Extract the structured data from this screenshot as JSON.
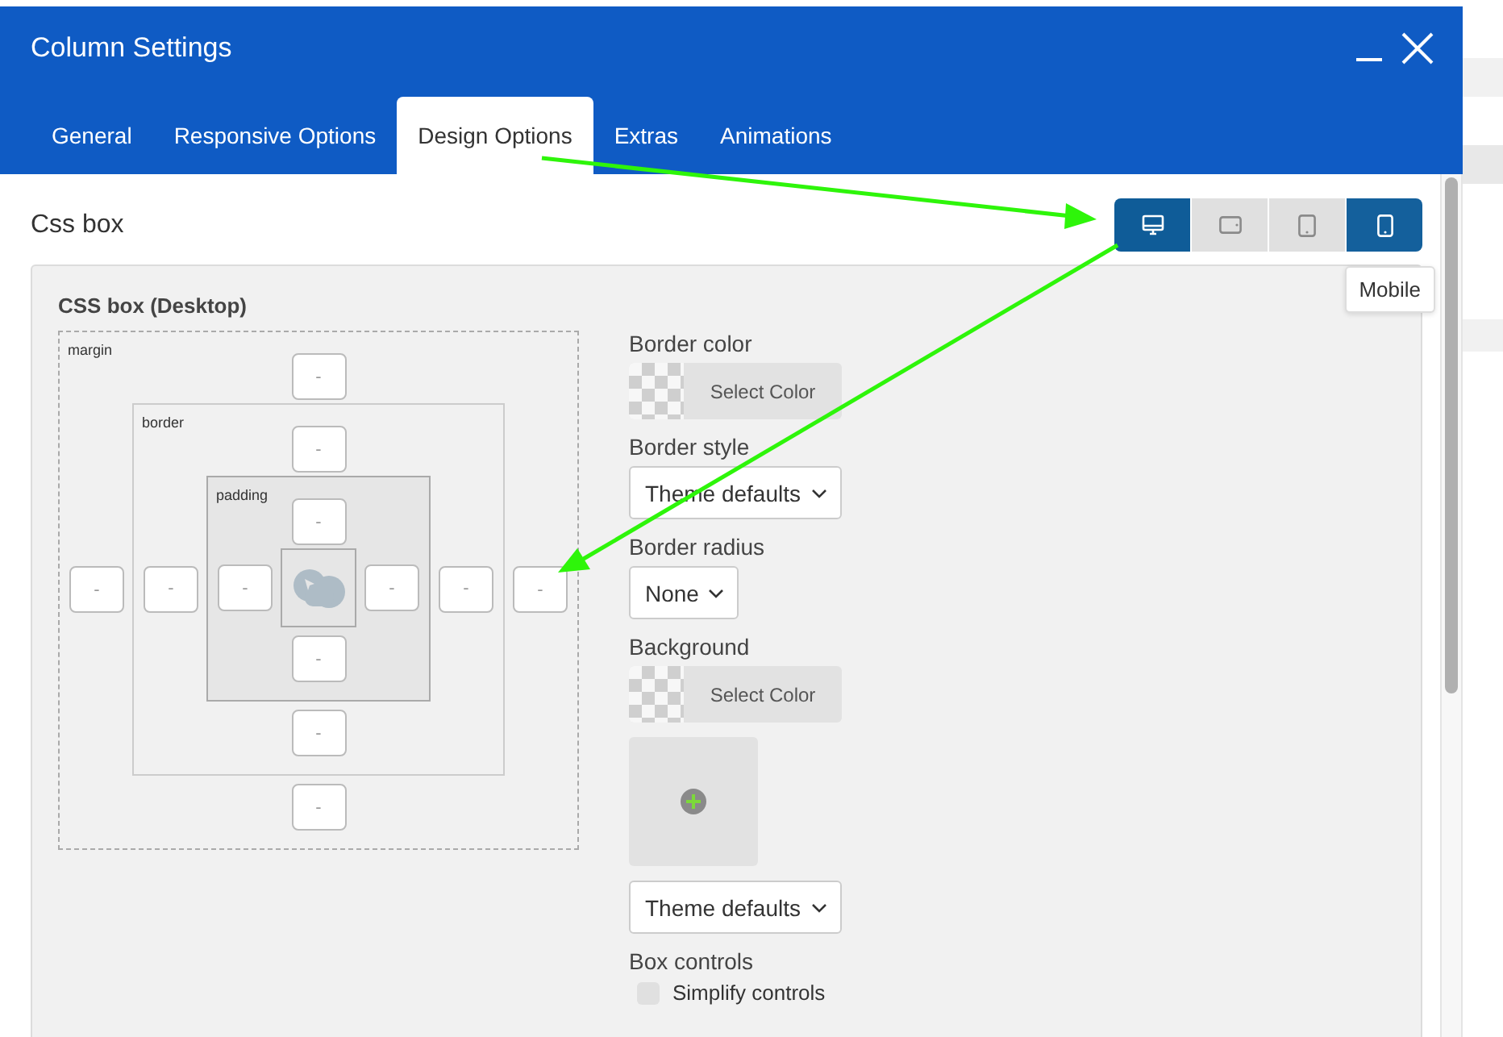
{
  "window": {
    "title": "Column Settings"
  },
  "tabs": [
    {
      "label": "General",
      "selected": false
    },
    {
      "label": "Responsive Options",
      "selected": false
    },
    {
      "label": "Design Options",
      "selected": true
    },
    {
      "label": "Extras",
      "selected": false
    },
    {
      "label": "Animations",
      "selected": false
    }
  ],
  "section_title": "Css box",
  "devices": [
    {
      "kind": "desktop",
      "selected": true,
      "hovered": false
    },
    {
      "kind": "tablet-landscape",
      "selected": false,
      "hovered": false
    },
    {
      "kind": "tablet-portrait",
      "selected": false,
      "hovered": false
    },
    {
      "kind": "mobile",
      "selected": false,
      "hovered": true,
      "tooltip": "Mobile"
    }
  ],
  "css_box": {
    "title": "CSS box (Desktop)",
    "layers": [
      {
        "label": "margin",
        "top": {
          "placeholder": "-"
        },
        "right": {
          "placeholder": "-"
        },
        "bottom": {
          "placeholder": "-"
        },
        "left": {
          "placeholder": "-"
        }
      },
      {
        "label": "border",
        "top": {
          "placeholder": "-"
        },
        "right": {
          "placeholder": "-"
        },
        "bottom": {
          "placeholder": "-"
        },
        "left": {
          "placeholder": "-"
        }
      },
      {
        "label": "padding",
        "top": {
          "placeholder": "-"
        },
        "right": {
          "placeholder": "-"
        },
        "bottom": {
          "placeholder": "-"
        },
        "left": {
          "placeholder": "-"
        }
      }
    ]
  },
  "options": [
    {
      "kind": "color",
      "label": "Border color",
      "button": "Select Color"
    },
    {
      "kind": "select",
      "label": "Border style",
      "value": "Theme defaults"
    },
    {
      "kind": "select",
      "label": "Border radius",
      "value": "None"
    },
    {
      "kind": "color",
      "label": "Background",
      "button": "Select Color"
    },
    {
      "kind": "image"
    },
    {
      "kind": "select",
      "value": "Theme defaults"
    },
    {
      "kind": "checkbox",
      "label": "Box controls",
      "text": "Simplify controls",
      "checked": false
    }
  ]
}
